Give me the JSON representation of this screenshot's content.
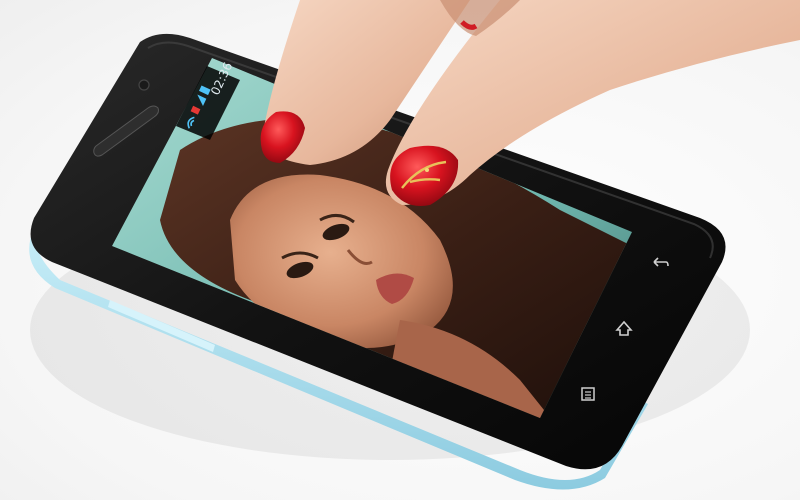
{
  "status_bar": {
    "time": "02:36",
    "icons": [
      "wifi-icon",
      "no-sim-icon",
      "signal-icon",
      "battery-icon"
    ]
  },
  "nav_buttons": [
    "back-icon",
    "home-icon",
    "menu-icon"
  ],
  "colors": {
    "phone_body": "#141414",
    "case_edge": "#9fd9ec",
    "screen_bg": "#8fcfc6",
    "nail_polish": "#d8131f"
  }
}
